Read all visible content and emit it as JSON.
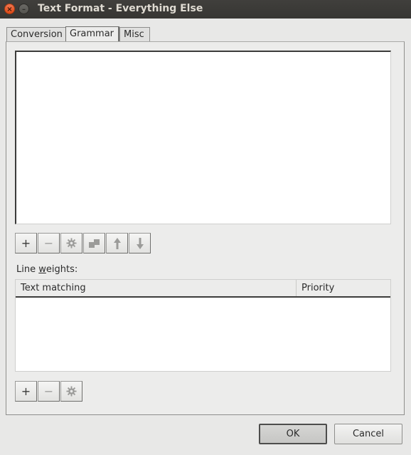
{
  "window": {
    "title": "Text Format - Everything Else",
    "close_glyph": "×",
    "minimize_glyph": "–"
  },
  "tabs": [
    {
      "label": "Conversion",
      "active": false
    },
    {
      "label": "Grammar",
      "active": true
    },
    {
      "label": "Misc",
      "active": false
    }
  ],
  "grammar_toolbar": [
    {
      "name": "add",
      "glyph": "+",
      "enabled": true,
      "icon": "plus-icon"
    },
    {
      "name": "remove",
      "glyph": "−",
      "enabled": false,
      "icon": "minus-icon"
    },
    {
      "name": "settings",
      "glyph": "",
      "enabled": false,
      "icon": "gear-icon"
    },
    {
      "name": "copy",
      "glyph": "",
      "enabled": false,
      "icon": "copy-icon"
    },
    {
      "name": "move-up",
      "glyph": "",
      "enabled": false,
      "icon": "arrow-up-icon"
    },
    {
      "name": "move-down",
      "glyph": "",
      "enabled": false,
      "icon": "arrow-down-icon"
    }
  ],
  "line_weights": {
    "label_prefix": "Line ",
    "label_mnemonic": "w",
    "label_suffix": "eights:",
    "columns": [
      "Text matching",
      "Priority"
    ],
    "rows": []
  },
  "weights_toolbar": [
    {
      "name": "add",
      "glyph": "+",
      "enabled": true,
      "icon": "plus-icon"
    },
    {
      "name": "remove",
      "glyph": "−",
      "enabled": false,
      "icon": "minus-icon"
    },
    {
      "name": "settings",
      "glyph": "",
      "enabled": false,
      "icon": "gear-icon"
    }
  ],
  "buttons": {
    "ok": "OK",
    "cancel": "Cancel"
  },
  "colors": {
    "titlebar": "#3c3b37",
    "close": "#e95420",
    "window_bg": "#e8e8e7"
  }
}
